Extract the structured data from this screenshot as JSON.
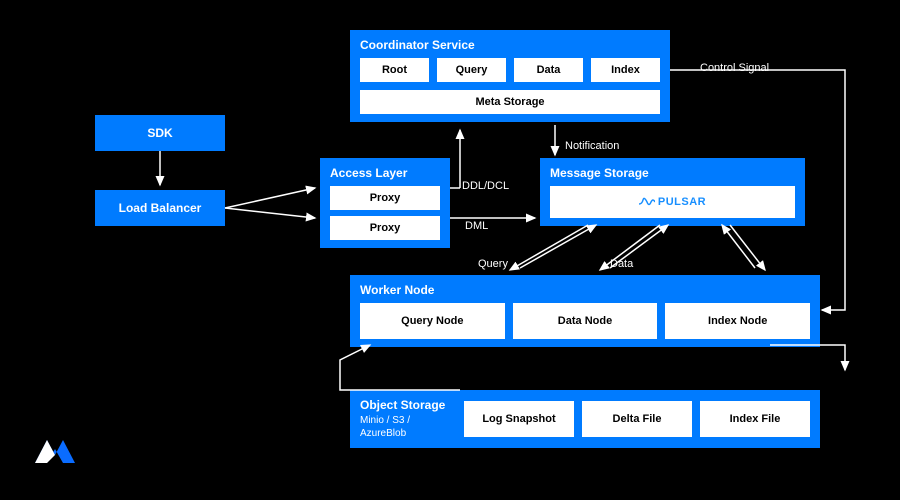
{
  "sdk": {
    "label": "SDK"
  },
  "loadBalancer": {
    "label": "Load Balancer"
  },
  "coordinator": {
    "title": "Coordinator Service",
    "items": [
      "Root",
      "Query",
      "Data",
      "Index"
    ],
    "meta": "Meta Storage"
  },
  "accessLayer": {
    "title": "Access Layer",
    "proxy1": "Proxy",
    "proxy2": "Proxy"
  },
  "messageStorage": {
    "title": "Message Storage",
    "pulsar": "PULSAR"
  },
  "workerNode": {
    "title": "Worker Node",
    "items": [
      "Query Node",
      "Data Node",
      "Index Node"
    ]
  },
  "objectStorage": {
    "title": "Object Storage",
    "subtitle": "Minio / S3 / AzureBlob",
    "items": [
      "Log Snapshot",
      "Delta File",
      "Index File"
    ]
  },
  "labels": {
    "controlSignal": "Control Signal",
    "notification": "Notification",
    "ddlDcl": "DDL/DCL",
    "dml": "DML",
    "query": "Query",
    "data": "Data"
  },
  "colors": {
    "bg": "#000000",
    "accent": "#007bff",
    "white": "#ffffff"
  }
}
